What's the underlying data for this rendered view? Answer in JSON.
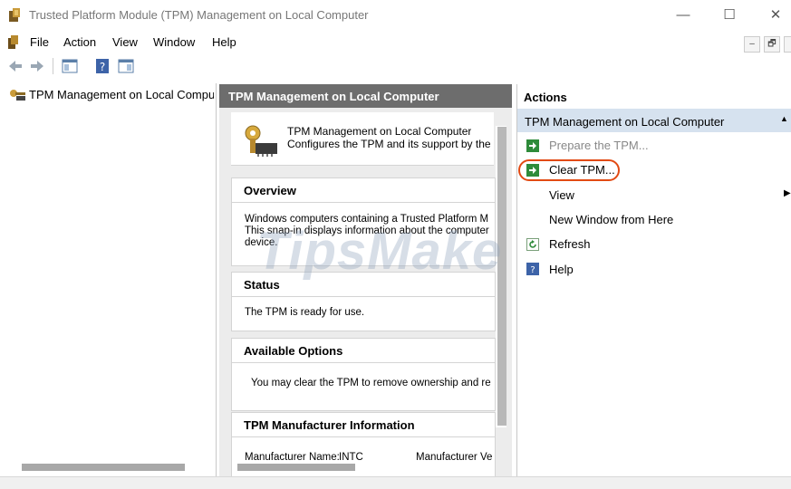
{
  "window": {
    "title": "Trusted Platform Module (TPM) Management on Local Computer",
    "controls": {
      "minimize": "—",
      "maximize": "☐",
      "close": "✕"
    }
  },
  "menu": [
    "File",
    "Action",
    "View",
    "Window",
    "Help"
  ],
  "mdi_controls": {
    "minimize": "–",
    "restore": "🗗"
  },
  "tree": {
    "item_label": "TPM Management on Local Computer"
  },
  "center": {
    "header": "TPM Management on Local Computer",
    "intro_title": "TPM Management on Local Computer",
    "intro_desc": "Configures the TPM and its support by the W",
    "overview": {
      "title": "Overview",
      "lines": [
        "Windows computers containing a Trusted Platform M",
        "This snap-in displays information about the computer",
        "device."
      ]
    },
    "status": {
      "title": "Status",
      "text": "The TPM is ready for use."
    },
    "options": {
      "title": "Available Options",
      "text": "You may clear the TPM to remove ownership and re"
    },
    "manufacturer": {
      "title": "TPM Manufacturer Information",
      "name_label": "Manufacturer Name:",
      "name_value": "INTC",
      "version_label": "Manufacturer Ve"
    }
  },
  "actions": {
    "title": "Actions",
    "section": "TPM Management on Local Computer",
    "items": [
      {
        "label": "Prepare the TPM...",
        "icon": "green-arrow-icon",
        "enabled": false
      },
      {
        "label": "Clear TPM...",
        "icon": "green-arrow-icon",
        "enabled": true,
        "highlighted": true
      },
      {
        "label": "View",
        "icon": "",
        "has_submenu": true
      },
      {
        "label": "New Window from Here",
        "icon": ""
      },
      {
        "label": "Refresh",
        "icon": "refresh-icon"
      },
      {
        "label": "Help",
        "icon": "help-icon"
      }
    ]
  },
  "watermark": "TipsMake",
  "colors": {
    "highlight": "#e24a13",
    "section_bg": "#d6e2ef",
    "header_bg": "#6d6d6d",
    "action_green": "#2e8b3a"
  }
}
